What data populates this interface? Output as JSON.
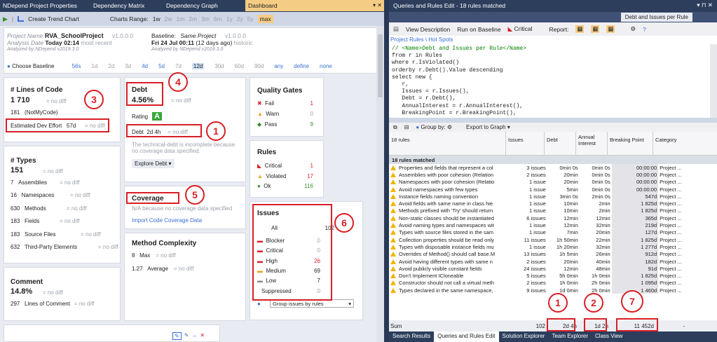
{
  "left_tabs": [
    {
      "label": "NDepend Project Properties"
    },
    {
      "label": "Dependency Matrix"
    },
    {
      "label": "Dependency Graph"
    },
    {
      "label": "Dashboard",
      "active": true
    }
  ],
  "toolbar": {
    "create_trend": "Create Trend Chart",
    "charts_range_label": "Charts Range:",
    "ranges": [
      "1w",
      "2w",
      "1m",
      "2m",
      "3m",
      "6m",
      "1y",
      "2y",
      "5y",
      "max"
    ]
  },
  "project": {
    "name_label": "Project Name",
    "name": "RVA_SchoolProject",
    "version": "v1.0.0.0",
    "analysis_label": "Analysis Date",
    "analysis_date": "Today 02:14",
    "analysis_suffix": "most recent",
    "analyzed_by": "Analyzed by NDepend v2019.3.0",
    "baseline_label": "Baseline:",
    "baseline_name": "Same Project",
    "baseline_version": "v1.0.0.0",
    "baseline_date": "Fri 24 Jul 00:11",
    "baseline_ago": "(12 days ago)",
    "baseline_suffix": "historic",
    "baseline_by": "Analyzed by NDepend v2019.3.0"
  },
  "baseline_bar": {
    "label": "Choose Baseline",
    "options": [
      "56s",
      "1d",
      "2d",
      "3d",
      "4d",
      "5d",
      "7d",
      "12d",
      "30d",
      "60d",
      "90d",
      "any",
      "define",
      "none"
    ]
  },
  "loc": {
    "title": "# Lines of Code",
    "value": "1 710",
    "nodiff": "no diff",
    "notmycode_val": "181",
    "notmycode_label": "(NotMyCode)",
    "effort_label": "Estimated Dev Effort",
    "effort_val": "57d"
  },
  "types": {
    "title": "# Types",
    "value": "151",
    "nodiff": "no diff",
    "items": [
      {
        "v": "7",
        "l": "Assemblies"
      },
      {
        "v": "16",
        "l": "Namespaces"
      },
      {
        "v": "630",
        "l": "Methods"
      },
      {
        "v": "183",
        "l": "Fields"
      },
      {
        "v": "183",
        "l": "Source Files"
      },
      {
        "v": "632",
        "l": "Third-Party Elements"
      }
    ]
  },
  "comment": {
    "title": "Comment",
    "value": "14.8%",
    "nodiff": "no diff",
    "lines_val": "297",
    "lines_label": "Lines of Comment"
  },
  "debt": {
    "title": "Debt",
    "value": "4.56%",
    "nodiff": "no diff",
    "rating_label": "Rating",
    "rating": "A",
    "debt_label": "Debt",
    "debt_val": "2d  4h",
    "note": "The technical-debt is incomplete because no coverage data specified.",
    "explore": "Explore Debt"
  },
  "coverage": {
    "title": "Coverage",
    "note": "N/A because no coverage data specified",
    "import": "Import Code Coverage Data"
  },
  "complexity": {
    "title": "Method Complexity",
    "max_val": "8",
    "max_label": "Max",
    "avg_val": "1.27",
    "avg_label": "Average",
    "nodiff": "no diff"
  },
  "quality_gates": {
    "title": "Quality Gates",
    "items": [
      {
        "l": "Fail",
        "v": "1",
        "c": "#d81f26"
      },
      {
        "l": "Warn",
        "v": "0",
        "c": "#9aa0a8"
      },
      {
        "l": "Pass",
        "v": "9",
        "c": "#3a8f2b"
      }
    ]
  },
  "rules": {
    "title": "Rules",
    "items": [
      {
        "l": "Critical",
        "v": "1",
        "c": "#d81f26"
      },
      {
        "l": "Violated",
        "v": "17",
        "c": "#d81f26"
      },
      {
        "l": "Ok",
        "v": "116",
        "c": "#3a8f2b"
      }
    ]
  },
  "issues": {
    "title": "Issues",
    "all_label": "All",
    "all_val": "102",
    "items": [
      {
        "l": "Blocker",
        "v": "0",
        "c": "#9aa0a8"
      },
      {
        "l": "Critical",
        "v": "0",
        "c": "#9aa0a8"
      },
      {
        "l": "High",
        "v": "26",
        "c": "#d81f26"
      },
      {
        "l": "Medium",
        "v": "69",
        "c": "#1e1e1e"
      },
      {
        "l": "Low",
        "v": "7",
        "c": "#1e1e1e"
      },
      {
        "l": "Suppressed",
        "v": "0",
        "c": "#9aa0a8"
      }
    ],
    "group_select": "Group issues by rules"
  },
  "callouts": {
    "c1": "1",
    "c3": "3",
    "c4": "4",
    "c5": "5",
    "c6": "6",
    "r1": "1",
    "r2": "2",
    "r7": "7"
  },
  "right": {
    "title": "Queries and Rules Edit  -  18 rules matched",
    "tab": "Debt and Issues per Rule",
    "tb": {
      "view_desc": "View Description",
      "run_baseline": "Run on Baseline",
      "critical": "Critical",
      "report": "Report:"
    },
    "breadcrumb": "Project Rules \\ Hot Spots",
    "code": [
      "// <Name>Debt and Issues per Rule</Name>",
      "from r in Rules",
      "where r.IsViolated()",
      "orderby r.Debt().Value descending",
      "select new {",
      "   r,",
      "   Issues = r.Issues(),",
      "   Debt = r.Debt(),",
      "   AnnualInterest = r.AnnualInterest(),",
      "   BreakingPoint = r.BreakingPoint(),",
      "   Category = ..."
    ],
    "grid_tb": {
      "group_by": "Group by:",
      "export": "Export to Graph"
    },
    "headers": {
      "rules": "18 rules",
      "issues": "Issues",
      "debt": "Debt",
      "interest": "Annual Interest",
      "bp": "Breaking Point",
      "cat": "Category"
    },
    "matched": "18 rules matched",
    "rows": [
      [
        "Properties and fields that represent a col",
        "3 issues",
        "0min  0s",
        "0min  0s",
        "00:00:00",
        "Project ..."
      ],
      [
        "Assemblies with poor cohesion (Relation",
        "2 issues",
        "20min",
        "0min  0s",
        "00:00:00",
        "Project ..."
      ],
      [
        "Namespaces with poor cohesion (Relatio",
        "1 issue",
        "20min",
        "0min  0s",
        "00:00:00",
        "Project ..."
      ],
      [
        "Avoid namespaces with few types",
        "1 issue",
        "5min",
        "0min  0s",
        "00:00:00",
        "Project ..."
      ],
      [
        "Instance fields naming convention",
        "1 issue",
        "3min  0s",
        "2min  0s",
        "547d",
        "Project ..."
      ],
      [
        "Avoid fields with same name in class hie",
        "1 issue",
        "10min",
        "2min",
        "1 825d",
        "Project ..."
      ],
      [
        "Methods prefixed with 'Try' should return",
        "1 issue",
        "10min",
        "2min",
        "1 825d",
        "Project ..."
      ],
      [
        "Non-static classes should be instantiated",
        "6 issues",
        "12min",
        "12min",
        "365d",
        "Project ..."
      ],
      [
        "Avoid naming types and namespaces wit",
        "1 issue",
        "12min",
        "32min",
        "219d",
        "Project ..."
      ],
      [
        "Types with source files stored in the sam",
        "1 issue",
        "7min",
        "20min",
        "127d",
        "Project ..."
      ],
      [
        "Collection properties should be read only",
        "11 issues",
        "1h  50min",
        "22min",
        "1 825d",
        "Project ..."
      ],
      [
        "Types with disposable instance fields mu",
        "1 issue",
        "1h  20min",
        "32min",
        "1 277d",
        "Project ..."
      ],
      [
        "Overrides of Method() should call base.M",
        "13 issues",
        "1h  5min",
        "26min",
        "912d",
        "Project ..."
      ],
      [
        "Avoid having different types with same n",
        "2 issues",
        "20min",
        "40min",
        "182d",
        "Project ..."
      ],
      [
        "Avoid publicly visible constant fields",
        "24 issues",
        "12min",
        "48min",
        "91d",
        "Project ..."
      ],
      [
        "Don't Implement ICloneable",
        "5 issues",
        "5h  0min",
        "1h  0min",
        "1 825d",
        "Project ..."
      ],
      [
        "Constructor should not call a virtual meth",
        "2 issues",
        "1h  0min",
        "2h  0min",
        "1 095d",
        "Project ..."
      ],
      [
        "Types declared in the same namespace,",
        "9 issues",
        "1d  0min",
        "2h  0min",
        "1 460d",
        "Project ..."
      ]
    ],
    "sum": {
      "label": "Sum",
      "issues": "102",
      "debt": "2d  4h",
      "interest": "1d  2h",
      "bp": "11 452d",
      "cat": "-"
    },
    "bottom_tabs": [
      "Search Results",
      "Queries and Rules Edit",
      "Solution Explorer",
      "Team Explorer",
      "Class View"
    ]
  }
}
